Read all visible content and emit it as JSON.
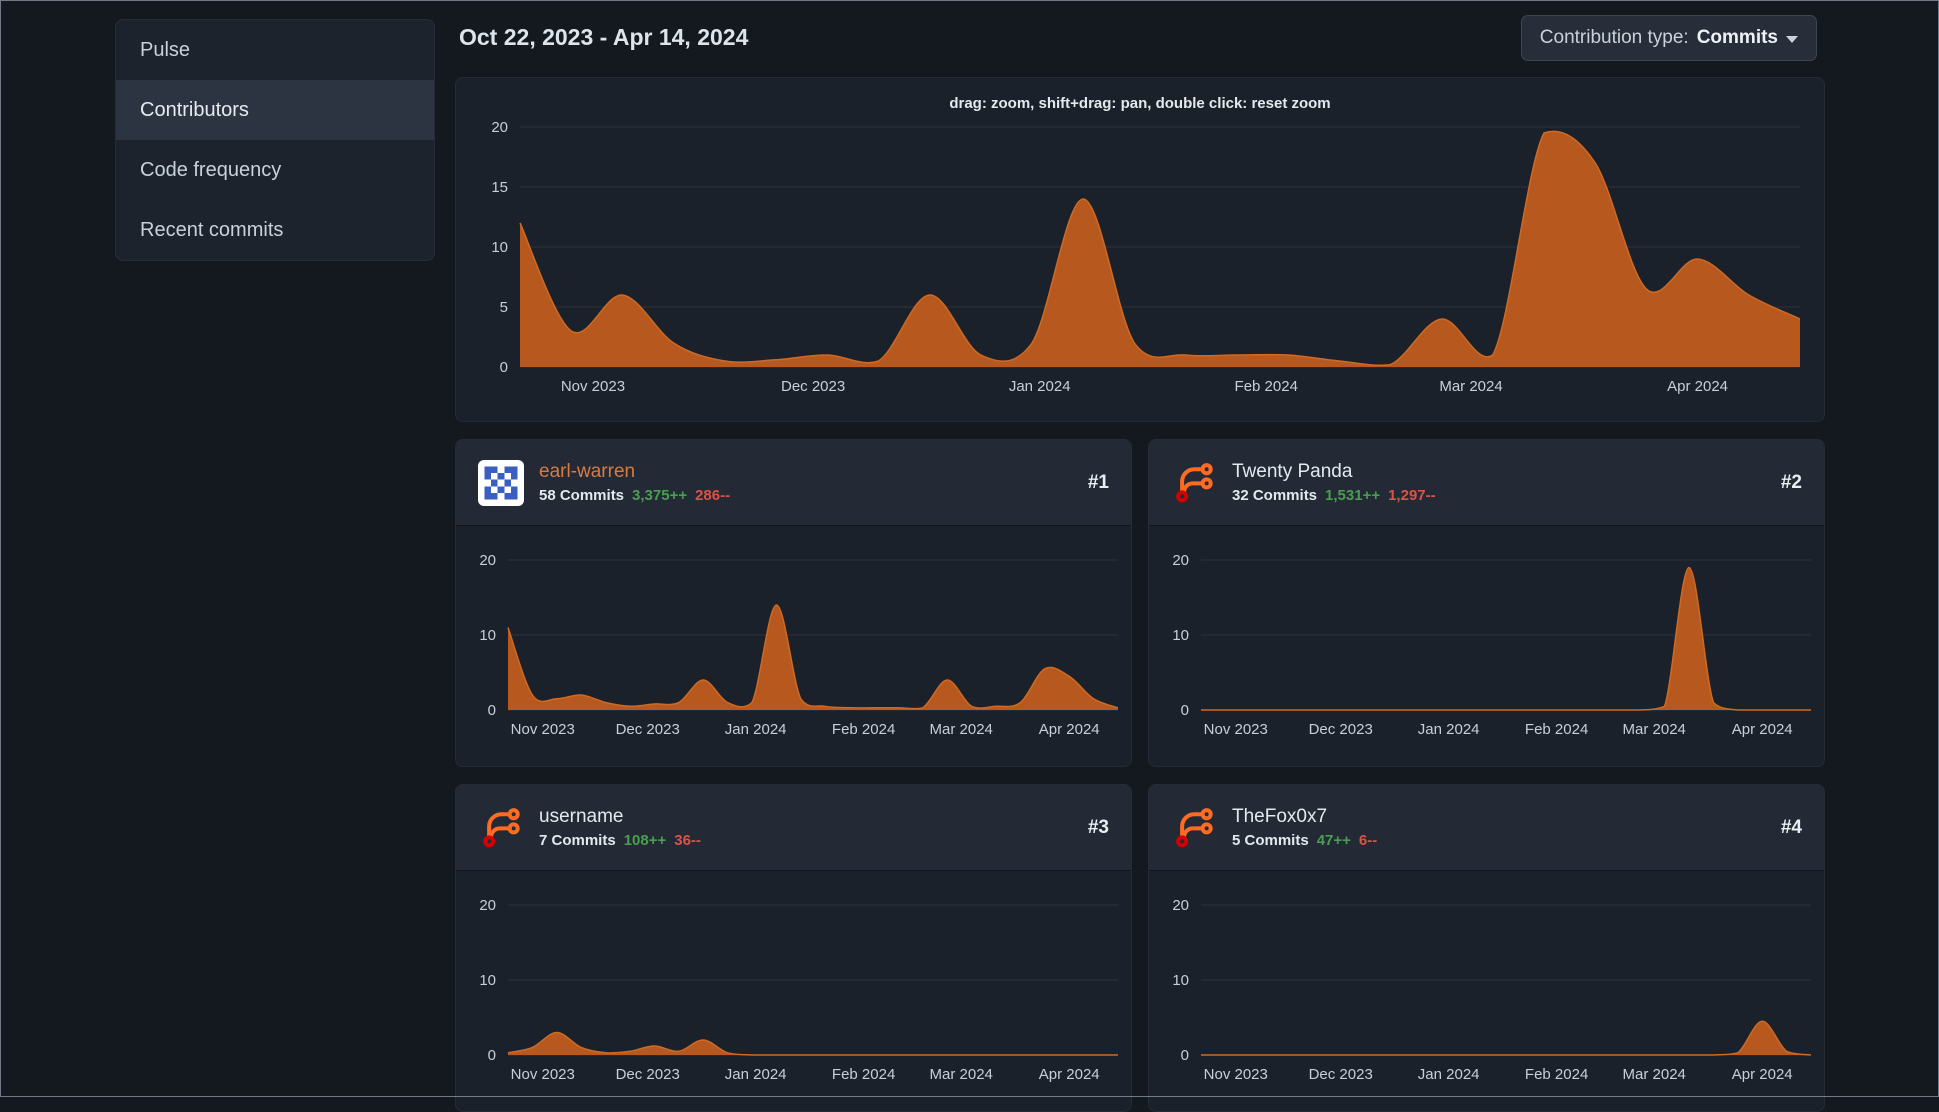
{
  "sidebar": {
    "items": [
      {
        "label": "Pulse",
        "active": false
      },
      {
        "label": "Contributors",
        "active": true
      },
      {
        "label": "Code frequency",
        "active": false
      },
      {
        "label": "Recent commits",
        "active": false
      }
    ]
  },
  "header": {
    "date_range": "Oct 22, 2023 - Apr 14, 2024",
    "contribution_type_label": "Contribution type:",
    "contribution_type_value": "Commits"
  },
  "colors": {
    "page_background": "#141920",
    "panel_background": "#1b212a",
    "accent_orange": "#c05c1e",
    "accent_orange_line": "#cf6a24",
    "additions_green": "#4a9e51",
    "deletions_red": "#dd5244",
    "linked_name_orange": "#da7b3d",
    "grid_line": "#2b323d",
    "axis_text": "#c8cfd7"
  },
  "contributors": [
    {
      "rank": "#1",
      "name": "earl-warren",
      "commits": "58 Commits",
      "additions": "3,375++",
      "deletions": "286--",
      "avatar": "identicon-blue-white",
      "name_is_link": true
    },
    {
      "rank": "#2",
      "name": "Twenty Panda",
      "commits": "32 Commits",
      "additions": "1,531++",
      "deletions": "1,297--",
      "avatar": "forgejo-logo",
      "name_is_link": false
    },
    {
      "rank": "#3",
      "name": "username",
      "commits": "7 Commits",
      "additions": "108++",
      "deletions": "36--",
      "avatar": "forgejo-logo",
      "name_is_link": false
    },
    {
      "rank": "#4",
      "name": "TheFox0x7",
      "commits": "5 Commits",
      "additions": "47++",
      "deletions": "6--",
      "avatar": "forgejo-logo",
      "name_is_link": false
    }
  ],
  "chart_data": [
    {
      "id": "main-contributions",
      "type": "area",
      "title": "drag: zoom, shift+drag: pan, double click: reset zoom",
      "period": "weekly",
      "start": "Oct 22, 2023",
      "end": "Apr 14, 2024",
      "ylim": [
        0,
        20
      ],
      "y_ticks": [
        0,
        5,
        10,
        15,
        20
      ],
      "x_tick_labels": [
        "Nov 2023",
        "Dec 2023",
        "Jan 2024",
        "Feb 2024",
        "Mar 2024",
        "Apr 2024"
      ],
      "x_tick_fractions": [
        0.057,
        0.229,
        0.406,
        0.583,
        0.743,
        0.92
      ],
      "values": [
        12,
        3,
        6,
        2,
        0.5,
        0.6,
        1,
        0.5,
        6,
        1,
        2,
        14,
        2,
        1,
        1,
        1,
        0.5,
        0.2,
        4,
        1,
        19.5,
        17,
        6.5,
        9,
        6,
        4
      ]
    },
    {
      "id": "earl-warren",
      "type": "area",
      "period": "weekly",
      "ylim": [
        0,
        20
      ],
      "y_ticks": [
        0,
        10,
        20
      ],
      "x_tick_labels": [
        "Nov 2023",
        "Dec 2023",
        "Jan 2024",
        "Feb 2024",
        "Mar 2024",
        "Apr 2024"
      ],
      "x_tick_fractions": [
        0.057,
        0.229,
        0.406,
        0.583,
        0.743,
        0.92
      ],
      "values": [
        11,
        2,
        1.5,
        2,
        1,
        0.5,
        0.8,
        1,
        4,
        1,
        1,
        14,
        1.5,
        0.5,
        0.3,
        0.3,
        0.3,
        0.3,
        4,
        0.5,
        0.5,
        1,
        5.5,
        4.5,
        1.5,
        0.3
      ]
    },
    {
      "id": "twenty-panda",
      "type": "area",
      "period": "weekly",
      "ylim": [
        0,
        20
      ],
      "y_ticks": [
        0,
        10,
        20
      ],
      "x_tick_labels": [
        "Nov 2023",
        "Dec 2023",
        "Jan 2024",
        "Feb 2024",
        "Mar 2024",
        "Apr 2024"
      ],
      "x_tick_fractions": [
        0.057,
        0.229,
        0.406,
        0.583,
        0.743,
        0.92
      ],
      "values": [
        0,
        0,
        0,
        0,
        0,
        0,
        0,
        0,
        0,
        0,
        0,
        0,
        0,
        0,
        0,
        0,
        0,
        0,
        0,
        0.5,
        19,
        1,
        0,
        0,
        0,
        0
      ]
    },
    {
      "id": "username",
      "type": "area",
      "period": "weekly",
      "ylim": [
        0,
        20
      ],
      "y_ticks": [
        0,
        10,
        20
      ],
      "x_tick_labels": [
        "Nov 2023",
        "Dec 2023",
        "Jan 2024",
        "Feb 2024",
        "Mar 2024",
        "Apr 2024"
      ],
      "x_tick_fractions": [
        0.057,
        0.229,
        0.406,
        0.583,
        0.743,
        0.92
      ],
      "values": [
        0.3,
        1,
        3,
        1,
        0.3,
        0.5,
        1.2,
        0.5,
        2,
        0.3,
        0,
        0,
        0,
        0,
        0,
        0,
        0,
        0,
        0,
        0,
        0,
        0,
        0,
        0,
        0,
        0
      ]
    },
    {
      "id": "thefox0x7",
      "type": "area",
      "period": "weekly",
      "ylim": [
        0,
        20
      ],
      "y_ticks": [
        0,
        10,
        20
      ],
      "x_tick_labels": [
        "Nov 2023",
        "Dec 2023",
        "Jan 2024",
        "Feb 2024",
        "Mar 2024",
        "Apr 2024"
      ],
      "x_tick_fractions": [
        0.057,
        0.229,
        0.406,
        0.583,
        0.743,
        0.92
      ],
      "values": [
        0,
        0,
        0,
        0,
        0,
        0,
        0,
        0,
        0,
        0,
        0,
        0,
        0,
        0,
        0,
        0,
        0,
        0,
        0,
        0,
        0,
        0,
        0.3,
        4.5,
        0.5,
        0
      ]
    }
  ]
}
